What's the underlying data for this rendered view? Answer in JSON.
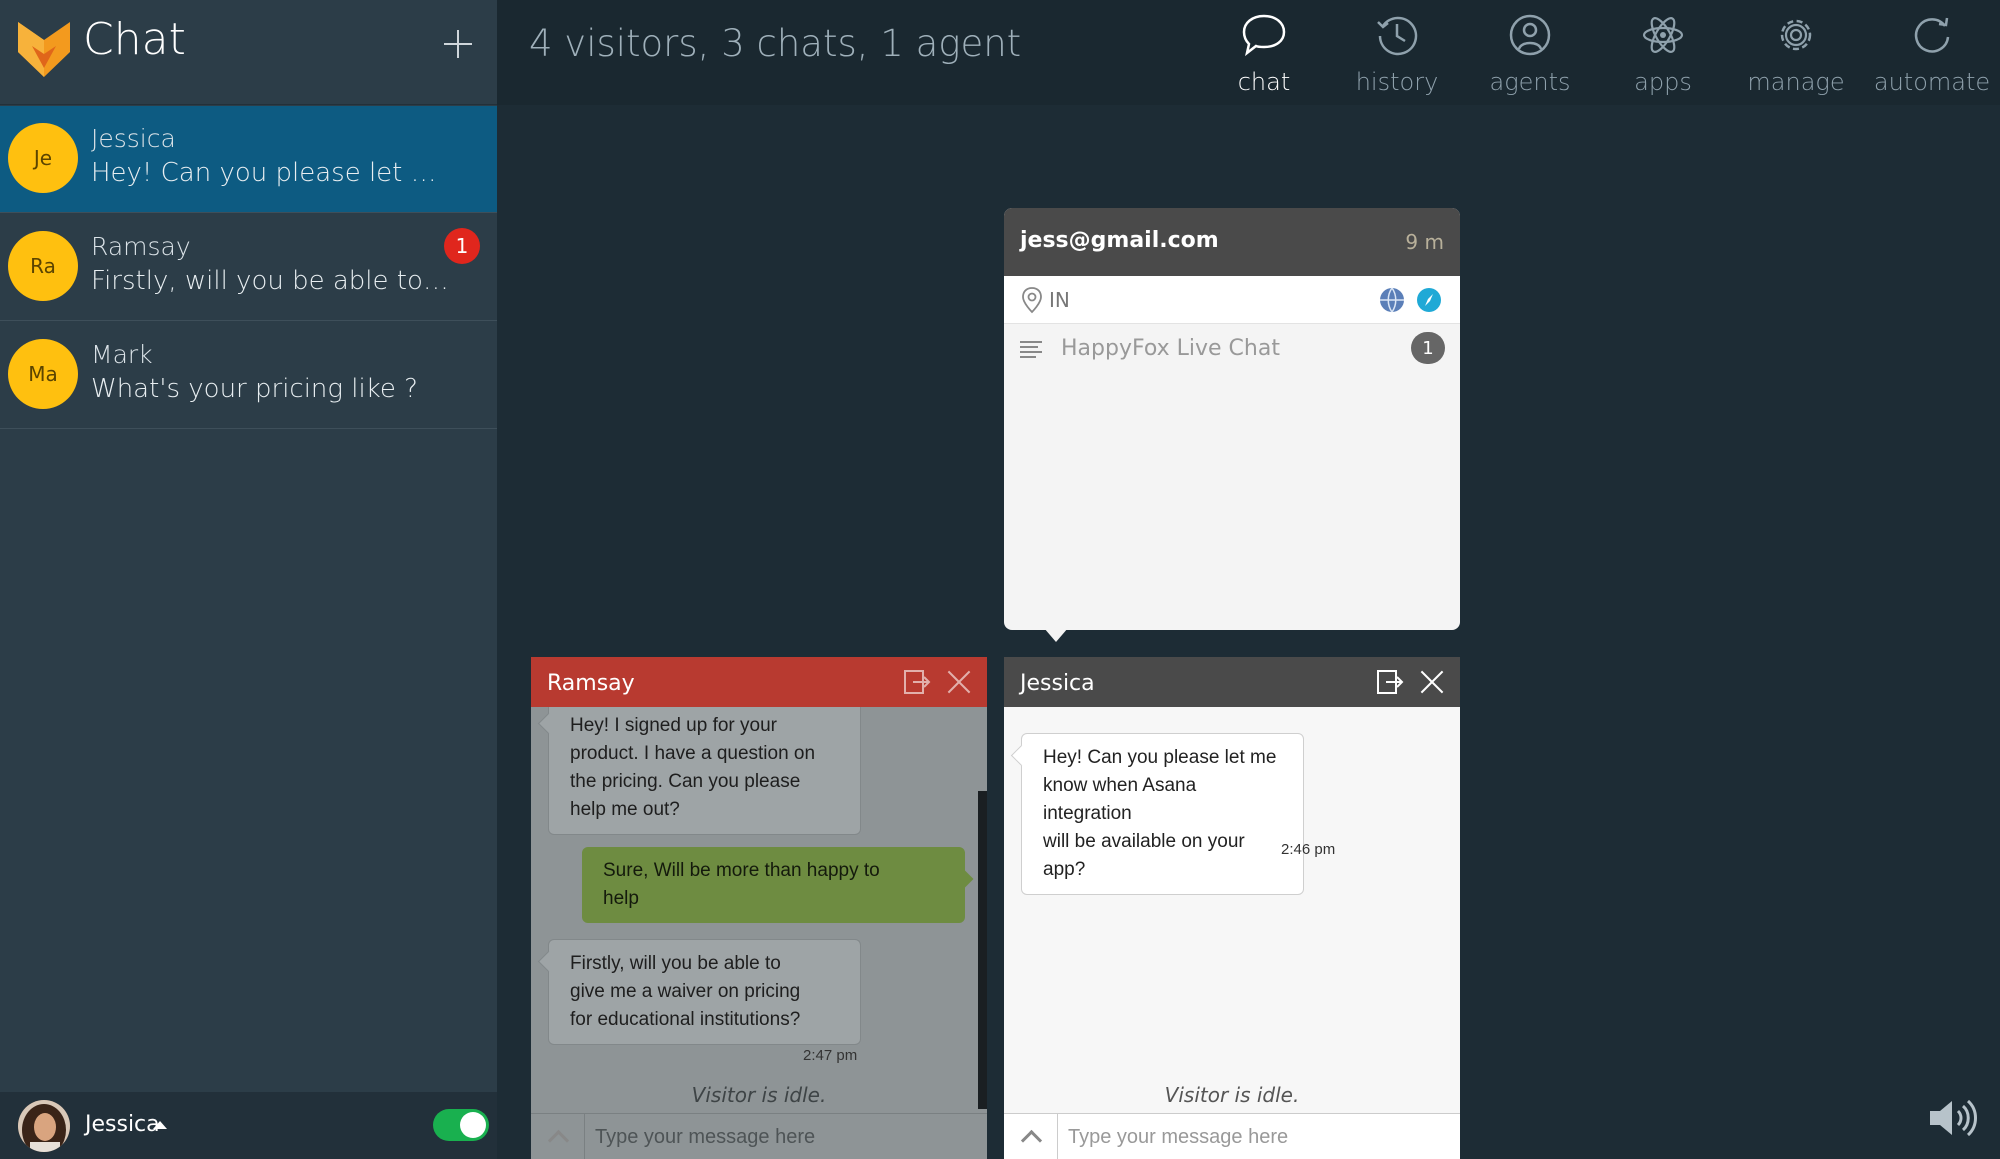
{
  "sidebar": {
    "title": "Chat",
    "chats": [
      {
        "initials": "Je",
        "name": "Jessica",
        "preview": "Hey! Can you please let me kn…",
        "badge": ""
      },
      {
        "initials": "Ra",
        "name": "Ramsay",
        "preview": "Firstly, will you be able to give…",
        "badge": "1"
      },
      {
        "initials": "Ma",
        "name": "Mark",
        "preview": "What's your pricing like ?",
        "badge": ""
      }
    ],
    "user": {
      "name": "Jessica"
    }
  },
  "topbar": {
    "summary": "4 visitors, 3 chats, 1 agent",
    "nav": [
      {
        "label": "chat",
        "icon": "speech-bubble-icon"
      },
      {
        "label": "history",
        "icon": "clock-icon"
      },
      {
        "label": "agents",
        "icon": "person-icon"
      },
      {
        "label": "apps",
        "icon": "atom-icon"
      },
      {
        "label": "manage",
        "icon": "gear-icon"
      },
      {
        "label": "automate",
        "icon": "refresh-icon"
      }
    ]
  },
  "visitor_card": {
    "email": "jess@gmail.com",
    "elapsed": "9 m",
    "country": "IN",
    "page_title": "HappyFox Live Chat",
    "page_count": "1"
  },
  "windows": {
    "ramsay": {
      "title": "Ramsay",
      "messages": [
        {
          "from": "visitor",
          "lines": [
            "Hey! I signed up for your",
            "product. I have a question on",
            "the pricing. Can you please",
            "help me out?"
          ]
        },
        {
          "from": "agent",
          "lines": [
            "Sure, Will be more than happy to",
            "help"
          ]
        },
        {
          "from": "visitor",
          "lines": [
            "Firstly, will you be able to",
            "give me a waiver on pricing",
            "for educational institutions?"
          ]
        }
      ],
      "timestamp": "2:47 pm",
      "idle": "Visitor is idle.",
      "placeholder": "Type your message here"
    },
    "jessica": {
      "title": "Jessica",
      "messages": [
        {
          "from": "visitor",
          "lines": [
            "Hey! Can you please let me",
            "know when Asana integration",
            "will be available on your app?"
          ]
        }
      ],
      "timestamp": "2:46 pm",
      "idle": "Visitor is idle.",
      "placeholder": "Type your message here"
    }
  },
  "colors": {
    "accent": "#0d5b82",
    "badge": "#e0261d",
    "avatar": "#ffc00f",
    "agent_bubble": "#8bc34a",
    "ramsay_header": "#b83a30",
    "online": "#19b04f"
  }
}
